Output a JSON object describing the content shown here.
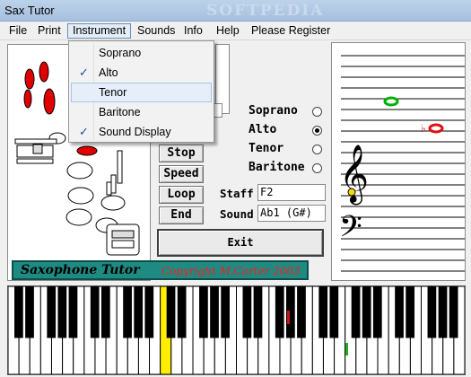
{
  "window": {
    "title": "Sax Tutor",
    "watermark": "SOFTPEDIA"
  },
  "menubar": {
    "items": [
      {
        "label": "File",
        "name": "menu-file"
      },
      {
        "label": "Print",
        "name": "menu-print"
      },
      {
        "label": "Instrument",
        "name": "menu-instrument"
      },
      {
        "label": "Sounds",
        "name": "menu-sounds"
      },
      {
        "label": "Info",
        "name": "menu-info"
      },
      {
        "label": "Help",
        "name": "menu-help"
      },
      {
        "label": "Please Register",
        "name": "menu-please-register"
      }
    ]
  },
  "instrument_menu": {
    "items": [
      {
        "label": "Soprano",
        "checked": false
      },
      {
        "label": "Alto",
        "checked": true
      },
      {
        "label": "Tenor",
        "checked": false,
        "highlighted": true
      },
      {
        "label": "Baritone",
        "checked": false
      },
      {
        "label": "Sound Display",
        "checked": true
      }
    ]
  },
  "buttons": {
    "stop": "Stop",
    "speed": "Speed",
    "loop": "Loop",
    "end": "End",
    "exit": "Exit"
  },
  "instrument_radios": {
    "selected": "Alto",
    "options": [
      "Soprano",
      "Alto",
      "Tenor",
      "Baritone"
    ]
  },
  "fields": {
    "staff_label": "Staff",
    "staff_value": "F2",
    "sound_label": "Sound",
    "sound_value": "Ab1 (G#)"
  },
  "banner": {
    "title": "Saxophone Tutor",
    "copyright": "Copyright M.Carter 2003"
  },
  "keyboard": {
    "highlight_color": "#ffee00",
    "marker_color_red": "#cc1111",
    "marker_color_green": "#22aa22"
  },
  "colors": {
    "pressed_key": "#ff0000",
    "note_green": "#00b000",
    "note_red": "#e01010"
  }
}
